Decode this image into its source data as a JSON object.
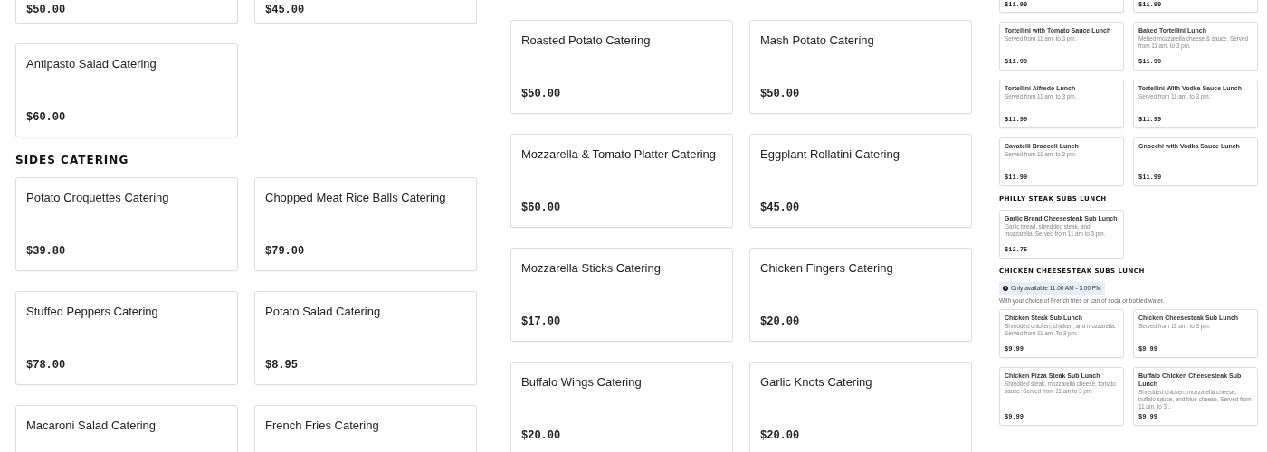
{
  "panels": [
    {
      "kind": "wide",
      "blocks": [
        {
          "kind": "cut_cards",
          "cards": [
            {
              "price": "$50.00"
            },
            {
              "price": "$45.00"
            }
          ]
        },
        {
          "kind": "cards",
          "cards": [
            {
              "title": "Antipasto Salad Catering",
              "price": "$60.00"
            }
          ]
        },
        {
          "kind": "heading",
          "text": "SIDES CATERING"
        },
        {
          "kind": "cards",
          "cards": [
            {
              "title": "Potato Croquettes Catering",
              "price": "$39.80"
            },
            {
              "title": "Chopped Meat Rice Balls Catering",
              "price": "$79.00"
            }
          ]
        },
        {
          "kind": "cards",
          "cards": [
            {
              "title": "Stuffed Peppers Catering",
              "price": "$78.00"
            },
            {
              "title": "Potato Salad Catering",
              "price": "$8.95"
            }
          ]
        },
        {
          "kind": "cards",
          "cards": [
            {
              "title": "Macaroni Salad Catering"
            },
            {
              "title": "French Fries Catering"
            }
          ]
        }
      ]
    },
    {
      "kind": "wide",
      "blocks": [
        {
          "kind": "cards",
          "cards": [
            {
              "title": "Roasted Potato Catering",
              "price": "$50.00"
            },
            {
              "title": "Mash Potato Catering",
              "price": "$50.00"
            }
          ]
        },
        {
          "kind": "cards",
          "cards": [
            {
              "title": "Mozzarella & Tomato Platter Catering",
              "price": "$60.00"
            },
            {
              "title": "Eggplant Rollatini Catering",
              "price": "$45.00"
            }
          ]
        },
        {
          "kind": "cards",
          "cards": [
            {
              "title": "Mozzarella Sticks Catering",
              "price": "$17.00"
            },
            {
              "title": "Chicken Fingers Catering",
              "price": "$20.00"
            }
          ]
        },
        {
          "kind": "cards",
          "cards": [
            {
              "title": "Buffalo Wings Catering",
              "price": "$20.00"
            },
            {
              "title": "Garlic Knots Catering",
              "price": "$20.00"
            }
          ]
        }
      ]
    },
    {
      "kind": "compact",
      "blocks": [
        {
          "kind": "cut_cards",
          "cards": [
            {
              "price": "$11.99"
            },
            {
              "price": "$11.99"
            }
          ]
        },
        {
          "kind": "cards",
          "cards": [
            {
              "title": "Tortellini with Tomato Sauce Lunch",
              "description": "Served from 11 am. to 3 pm.",
              "price": "$11.99"
            },
            {
              "title": "Baked Tortellini Lunch",
              "description": "Melted mozzarella cheese & sauce. Served from 11 am. to 3 pm.",
              "price": "$11.99"
            }
          ]
        },
        {
          "kind": "cards",
          "cards": [
            {
              "title": "Tortellini Alfredo Lunch",
              "description": "Served from 11 am. to 3 pm.",
              "price": "$11.99"
            },
            {
              "title": "Tortellini With Vodka Sauce Lunch",
              "description": "Served from 11 am. to 3 pm.",
              "price": "$11.99"
            }
          ]
        },
        {
          "kind": "cards",
          "cards": [
            {
              "title": "Cavatelli Broccoli Lunch",
              "description": "Served from 11 am. to 3 pm.",
              "price": "$11.99"
            },
            {
              "title": "Gnocchi with Vodka Sauce Lunch",
              "price": "$11.99"
            }
          ]
        },
        {
          "kind": "heading",
          "text": "PHILLY STEAK SUBS LUNCH"
        },
        {
          "kind": "cards",
          "cards": [
            {
              "title": "Garlic Bread Cheesesteak Sub Lunch",
              "description": "Garlic bread, shredded steak, and mozzarella. Served from 11 am to 3 pm.",
              "price": "$12.75"
            }
          ]
        },
        {
          "kind": "heading",
          "text": "CHICKEN CHEESESTEAK SUBS LUNCH"
        },
        {
          "kind": "notice",
          "text": "Only available 11:00 AM - 3:00 PM"
        },
        {
          "kind": "note",
          "text": "With your choice of French fries or can of soda or bottled water."
        },
        {
          "kind": "cards",
          "cards": [
            {
              "title": "Chicken Steak Sub Lunch",
              "description": "Shredded chicken, chicken, and mozzarella. Served from 11 am. To 3 pm.",
              "price": "$9.99"
            },
            {
              "title": "Chicken Cheesesteak Sub Lunch",
              "description": "Served from 11 am. to 3 pm.",
              "price": "$9.99"
            }
          ]
        },
        {
          "kind": "cards",
          "cards": [
            {
              "title": "Chicken Pizza Steak Sub Lunch",
              "description": "Shredded steak, mozzarella cheese, tomato sauce. Served from 11 am to 3 pm.",
              "price": "$9.99"
            },
            {
              "title": "Buffalo Chicken Cheesesteak Sub Lunch",
              "description": "Shredded chicken, mozzarella cheese, buffalo sauce, and blue cheese. Served from 11 am. to 3...",
              "price": "$9.99"
            }
          ]
        }
      ]
    }
  ]
}
